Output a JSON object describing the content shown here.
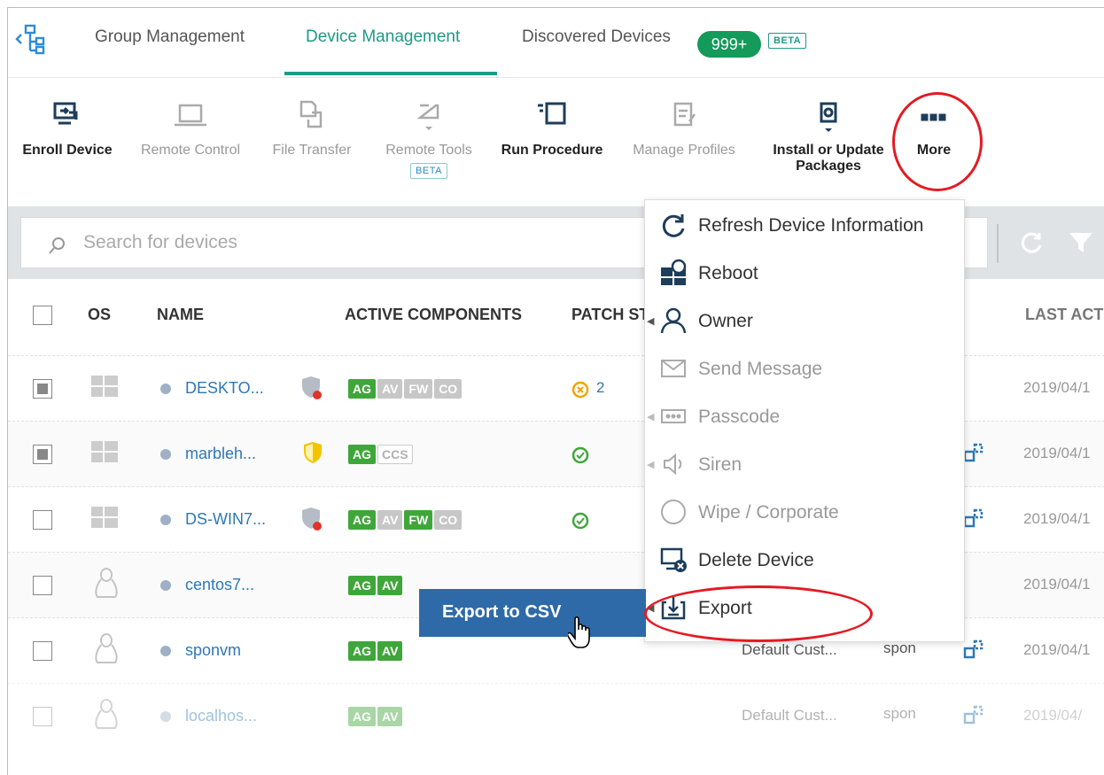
{
  "tabs": {
    "group": "Group Management",
    "device": "Device Management",
    "discovered": "Discovered Devices",
    "count": "999+",
    "beta": "BETA"
  },
  "toolbar": {
    "enroll": "Enroll Device",
    "remote_control": "Remote Control",
    "file_transfer": "File Transfer",
    "remote_tools": "Remote Tools",
    "remote_tools_beta": "BETA",
    "run_procedure": "Run Procedure",
    "manage_profiles": "Manage Profiles",
    "install_line1": "Install or Update",
    "install_line2": "Packages",
    "more": "More"
  },
  "search": {
    "placeholder": "Search for devices"
  },
  "table": {
    "headers": {
      "os": "OS",
      "name": "NAME",
      "active": "ACTIVE COMPONENTS",
      "patch": "PATCH ST",
      "last": "LAST ACT"
    },
    "rows": [
      {
        "name": "DESKTO...",
        "patch_count": "2",
        "date": "2019/04/1"
      },
      {
        "name": "marbleh...",
        "date": "2019/04/1"
      },
      {
        "name": "DS-WIN7...",
        "date": "2019/04/1"
      },
      {
        "name": "centos7...",
        "date": "2019/04/1"
      },
      {
        "name": "sponvm",
        "customer": "Default Cust...",
        "owner": "spon",
        "date": "2019/04/1"
      },
      {
        "name": "localhos...",
        "customer": "Default Cust...",
        "owner": "spon",
        "date": "2019/04/"
      }
    ]
  },
  "components": {
    "ag": "AG",
    "av": "AV",
    "fw": "FW",
    "co": "CO",
    "ccs": "CCS"
  },
  "menu": {
    "refresh": "Refresh Device Information",
    "reboot": "Reboot",
    "owner": "Owner",
    "send_message": "Send Message",
    "passcode": "Passcode",
    "siren": "Siren",
    "wipe": "Wipe / Corporate",
    "delete": "Delete Device",
    "export": "Export"
  },
  "submenu": {
    "export_csv": "Export to CSV"
  },
  "colors": {
    "accent": "#1e9a86",
    "highlight_ring": "#e31b23",
    "submenu_bg": "#2e6aa8",
    "chip_green": "#3fa63a"
  }
}
